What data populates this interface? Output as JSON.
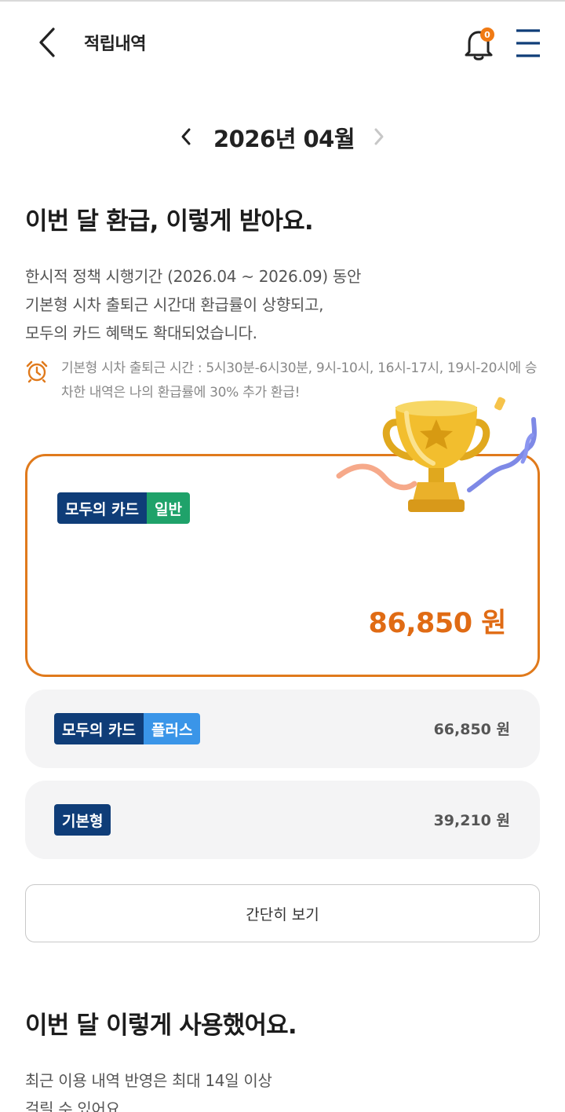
{
  "header": {
    "title": "적립내역",
    "notification_count": "0"
  },
  "month_nav": {
    "label": "2026년 04월"
  },
  "refund_section": {
    "title": "이번 달 환급, 이렇게 받아요.",
    "description_lines": [
      "한시적 정책 시행기간 (2026.04 ~ 2026.09) 동안",
      "기본형 시차 출퇴근 시간대 환급률이 상향되고,",
      "모두의 카드 혜택도 확대되었습니다."
    ],
    "notice": "기본형 시차 출퇴근 시간 : 5시30분-6시30분, 9시-10시, 16시-17시, 19시-20시에 승차한 내역은 나의 환급률에 30% 추가 환급!"
  },
  "cards": {
    "main": {
      "tag_primary": "모두의 카드",
      "tag_secondary": "일반",
      "amount": "86,850 원"
    },
    "plus": {
      "tag_primary": "모두의 카드",
      "tag_secondary": "플러스",
      "amount": "66,850 원"
    },
    "basic": {
      "tag_primary": "기본형",
      "amount": "39,210 원"
    }
  },
  "simple_view_button": "간단히 보기",
  "usage_section": {
    "title": "이번 달 이렇게 사용했어요.",
    "description_lines": [
      "최근 이용 내역 반영은 최대 14일 이상",
      "걸릴 수 있어요."
    ]
  },
  "colors": {
    "accent_orange": "#e07a1c",
    "navy": "#0f3d78",
    "green": "#1fa26a",
    "blue": "#3a95e8"
  },
  "icons": {
    "back": "chevron-left-icon",
    "notification": "bell-icon",
    "menu": "hamburger-menu-icon",
    "month_prev": "chevron-left-icon",
    "month_next": "chevron-right-icon",
    "notice": "alarm-clock-icon",
    "decoration": "trophy-icon"
  }
}
